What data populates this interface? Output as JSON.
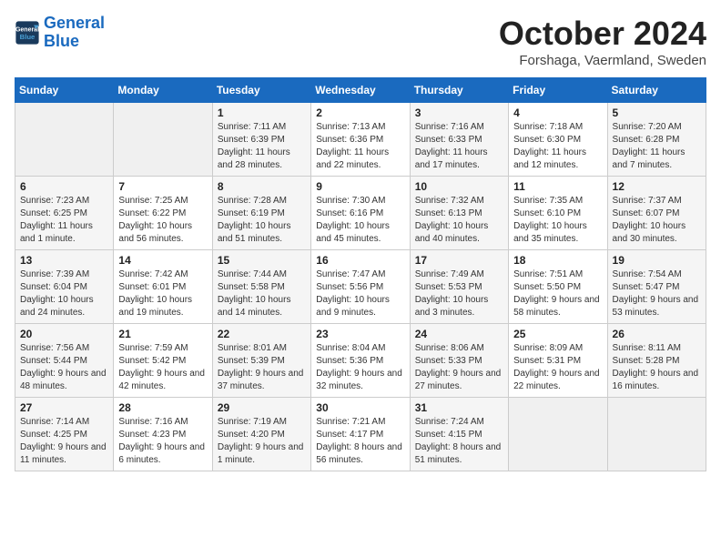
{
  "header": {
    "logo_line1": "General",
    "logo_line2": "Blue",
    "month": "October 2024",
    "location": "Forshaga, Vaermland, Sweden"
  },
  "weekdays": [
    "Sunday",
    "Monday",
    "Tuesday",
    "Wednesday",
    "Thursday",
    "Friday",
    "Saturday"
  ],
  "weeks": [
    [
      {
        "day": "",
        "info": ""
      },
      {
        "day": "",
        "info": ""
      },
      {
        "day": "1",
        "info": "Sunrise: 7:11 AM\nSunset: 6:39 PM\nDaylight: 11 hours and 28 minutes."
      },
      {
        "day": "2",
        "info": "Sunrise: 7:13 AM\nSunset: 6:36 PM\nDaylight: 11 hours and 22 minutes."
      },
      {
        "day": "3",
        "info": "Sunrise: 7:16 AM\nSunset: 6:33 PM\nDaylight: 11 hours and 17 minutes."
      },
      {
        "day": "4",
        "info": "Sunrise: 7:18 AM\nSunset: 6:30 PM\nDaylight: 11 hours and 12 minutes."
      },
      {
        "day": "5",
        "info": "Sunrise: 7:20 AM\nSunset: 6:28 PM\nDaylight: 11 hours and 7 minutes."
      }
    ],
    [
      {
        "day": "6",
        "info": "Sunrise: 7:23 AM\nSunset: 6:25 PM\nDaylight: 11 hours and 1 minute."
      },
      {
        "day": "7",
        "info": "Sunrise: 7:25 AM\nSunset: 6:22 PM\nDaylight: 10 hours and 56 minutes."
      },
      {
        "day": "8",
        "info": "Sunrise: 7:28 AM\nSunset: 6:19 PM\nDaylight: 10 hours and 51 minutes."
      },
      {
        "day": "9",
        "info": "Sunrise: 7:30 AM\nSunset: 6:16 PM\nDaylight: 10 hours and 45 minutes."
      },
      {
        "day": "10",
        "info": "Sunrise: 7:32 AM\nSunset: 6:13 PM\nDaylight: 10 hours and 40 minutes."
      },
      {
        "day": "11",
        "info": "Sunrise: 7:35 AM\nSunset: 6:10 PM\nDaylight: 10 hours and 35 minutes."
      },
      {
        "day": "12",
        "info": "Sunrise: 7:37 AM\nSunset: 6:07 PM\nDaylight: 10 hours and 30 minutes."
      }
    ],
    [
      {
        "day": "13",
        "info": "Sunrise: 7:39 AM\nSunset: 6:04 PM\nDaylight: 10 hours and 24 minutes."
      },
      {
        "day": "14",
        "info": "Sunrise: 7:42 AM\nSunset: 6:01 PM\nDaylight: 10 hours and 19 minutes."
      },
      {
        "day": "15",
        "info": "Sunrise: 7:44 AM\nSunset: 5:58 PM\nDaylight: 10 hours and 14 minutes."
      },
      {
        "day": "16",
        "info": "Sunrise: 7:47 AM\nSunset: 5:56 PM\nDaylight: 10 hours and 9 minutes."
      },
      {
        "day": "17",
        "info": "Sunrise: 7:49 AM\nSunset: 5:53 PM\nDaylight: 10 hours and 3 minutes."
      },
      {
        "day": "18",
        "info": "Sunrise: 7:51 AM\nSunset: 5:50 PM\nDaylight: 9 hours and 58 minutes."
      },
      {
        "day": "19",
        "info": "Sunrise: 7:54 AM\nSunset: 5:47 PM\nDaylight: 9 hours and 53 minutes."
      }
    ],
    [
      {
        "day": "20",
        "info": "Sunrise: 7:56 AM\nSunset: 5:44 PM\nDaylight: 9 hours and 48 minutes."
      },
      {
        "day": "21",
        "info": "Sunrise: 7:59 AM\nSunset: 5:42 PM\nDaylight: 9 hours and 42 minutes."
      },
      {
        "day": "22",
        "info": "Sunrise: 8:01 AM\nSunset: 5:39 PM\nDaylight: 9 hours and 37 minutes."
      },
      {
        "day": "23",
        "info": "Sunrise: 8:04 AM\nSunset: 5:36 PM\nDaylight: 9 hours and 32 minutes."
      },
      {
        "day": "24",
        "info": "Sunrise: 8:06 AM\nSunset: 5:33 PM\nDaylight: 9 hours and 27 minutes."
      },
      {
        "day": "25",
        "info": "Sunrise: 8:09 AM\nSunset: 5:31 PM\nDaylight: 9 hours and 22 minutes."
      },
      {
        "day": "26",
        "info": "Sunrise: 8:11 AM\nSunset: 5:28 PM\nDaylight: 9 hours and 16 minutes."
      }
    ],
    [
      {
        "day": "27",
        "info": "Sunrise: 7:14 AM\nSunset: 4:25 PM\nDaylight: 9 hours and 11 minutes."
      },
      {
        "day": "28",
        "info": "Sunrise: 7:16 AM\nSunset: 4:23 PM\nDaylight: 9 hours and 6 minutes."
      },
      {
        "day": "29",
        "info": "Sunrise: 7:19 AM\nSunset: 4:20 PM\nDaylight: 9 hours and 1 minute."
      },
      {
        "day": "30",
        "info": "Sunrise: 7:21 AM\nSunset: 4:17 PM\nDaylight: 8 hours and 56 minutes."
      },
      {
        "day": "31",
        "info": "Sunrise: 7:24 AM\nSunset: 4:15 PM\nDaylight: 8 hours and 51 minutes."
      },
      {
        "day": "",
        "info": ""
      },
      {
        "day": "",
        "info": ""
      }
    ]
  ]
}
